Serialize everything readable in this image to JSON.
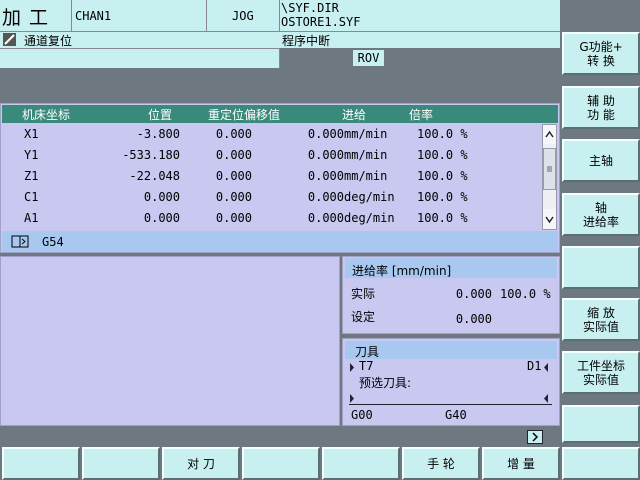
{
  "header": {
    "mode": "加 工",
    "channel": "CHAN1",
    "op_mode": "JOG",
    "program_dir": "\\SYF.DIR",
    "program_file": "OSTORE1.SYF",
    "channel_status": "通道复位",
    "program_status": "程序中断",
    "rov": "ROV"
  },
  "axis_table": {
    "headers": [
      "机床坐标",
      "位置",
      "重定位偏移值",
      "进给",
      "倍率"
    ],
    "rows": [
      {
        "axis": "X1",
        "pos": "-3.800",
        "offset": "0.000",
        "feed": "0.000",
        "unit": "mm/min",
        "ovr": "100.0 %"
      },
      {
        "axis": "Y1",
        "pos": "-533.180",
        "offset": "0.000",
        "feed": "0.000",
        "unit": "mm/min",
        "ovr": "100.0 %"
      },
      {
        "axis": "Z1",
        "pos": "-22.048",
        "offset": "0.000",
        "feed": "0.000",
        "unit": "mm/min",
        "ovr": "100.0 %"
      },
      {
        "axis": "C1",
        "pos": "0.000",
        "offset": "0.000",
        "feed": "0.000",
        "unit": "deg/min",
        "ovr": "100.0 %"
      },
      {
        "axis": "A1",
        "pos": "0.000",
        "offset": "0.000",
        "feed": "0.000",
        "unit": "deg/min",
        "ovr": "100.0 %"
      }
    ],
    "frame": "G54"
  },
  "feed_panel": {
    "title": "进给率 [mm/min]",
    "actual_label": "实际",
    "actual_value": "0.000",
    "actual_pct": "100.0 %",
    "set_label": "设定",
    "set_value": "0.000"
  },
  "tool_panel": {
    "title": "刀具",
    "tool": "T7",
    "d_num": "D1",
    "preselect_label": "预选刀具:",
    "g1": "G00",
    "g2": "G40"
  },
  "vsoftkeys": [
    {
      "l1": "G功能+",
      "l2": "转  换"
    },
    {
      "l1": "辅  助",
      "l2": "功  能"
    },
    {
      "l1": "主轴",
      "l2": ""
    },
    {
      "l1": "轴",
      "l2": "进给率"
    },
    {
      "l1": "",
      "l2": ""
    },
    {
      "l1": "缩  放",
      "l2": "实际值"
    },
    {
      "l1": "工件坐标",
      "l2": "实际值"
    },
    {
      "l1": "",
      "l2": ""
    }
  ],
  "hsoftkeys": [
    "",
    "",
    "对  刀",
    "",
    "",
    "手  轮",
    "增  量",
    ""
  ]
}
